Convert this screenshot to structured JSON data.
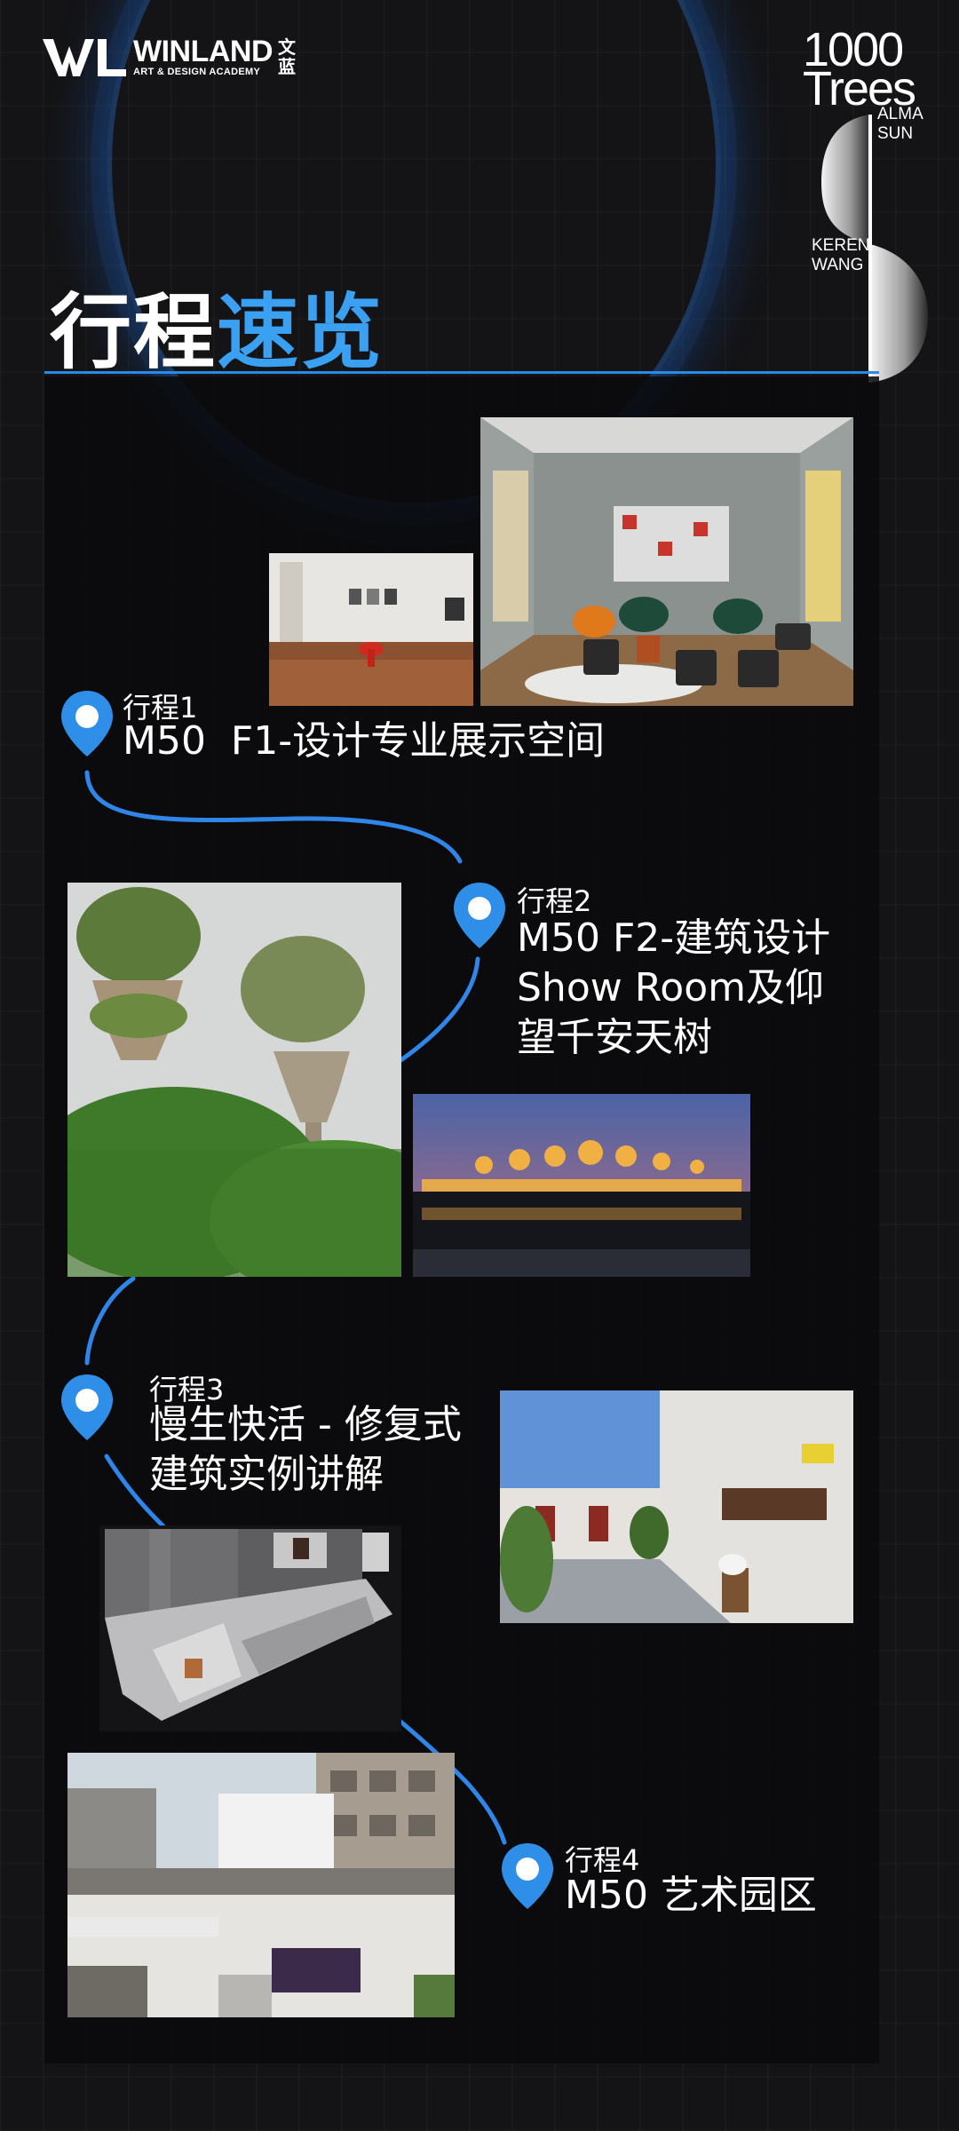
{
  "header": {
    "logo_name": "WINLAND",
    "logo_subtitle": "ART & DESIGN ACADEMY",
    "logo_cn": "文蓝",
    "brand_number": "1000",
    "brand_word": "Trees",
    "brand_credit_1": "ALMA SUN",
    "brand_credit_2": "KEREN WANG"
  },
  "page": {
    "title_white": "行程",
    "title_blue": "速览"
  },
  "colors": {
    "accent_blue": "#3aa0f2",
    "line_blue": "#2a8ae6",
    "panel_bg": "#0b0b0d",
    "page_bg": "#141416"
  },
  "itinerary": [
    {
      "label": "行程1",
      "title_lines": [
        "M50  F1-设计专业展示空间"
      ]
    },
    {
      "label": "行程2",
      "title_lines": [
        "M50 F2-建筑设计",
        "Show Room及仰",
        "望千安天树"
      ]
    },
    {
      "label": "行程3",
      "title_lines": [
        "慢生快活 - 修复式",
        "建筑实例讲解"
      ]
    },
    {
      "label": "行程4",
      "title_lines": [
        "M50 艺术园区"
      ]
    }
  ],
  "icons": {
    "pin": "location-pin-icon"
  }
}
